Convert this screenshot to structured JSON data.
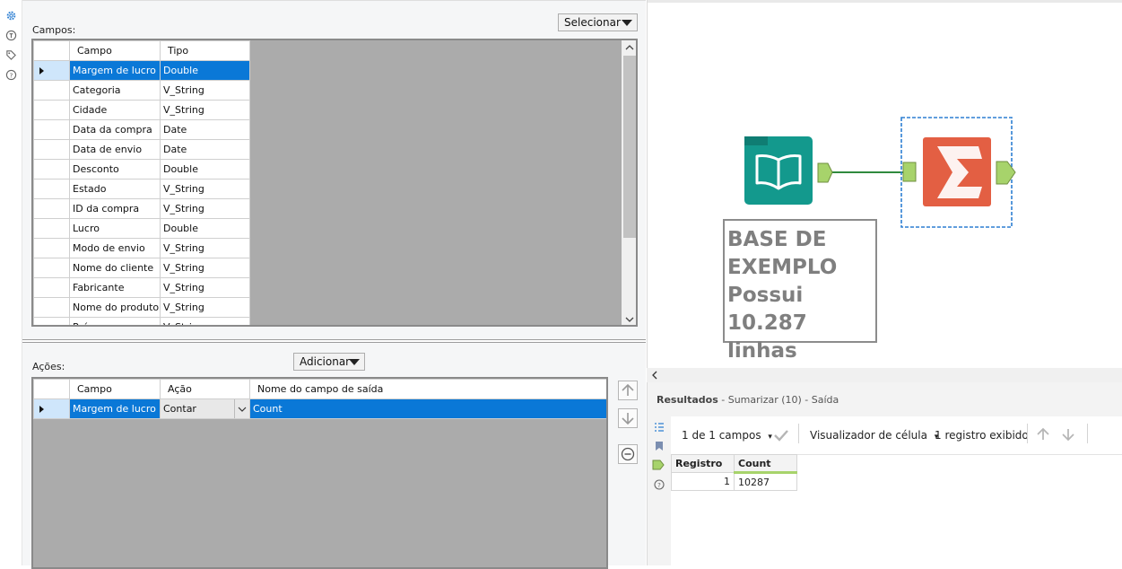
{
  "left_icons": [
    "gear-icon",
    "plug-icon",
    "tag-icon",
    "help-icon"
  ],
  "fields_section": {
    "label": "Campos:",
    "select_button": "Selecionar",
    "columns": [
      "Campo",
      "Tipo"
    ],
    "rows": [
      {
        "campo": "Margem de lucro",
        "tipo": "Double"
      },
      {
        "campo": "Categoria",
        "tipo": "V_String"
      },
      {
        "campo": "Cidade",
        "tipo": "V_String"
      },
      {
        "campo": "Data da compra",
        "tipo": "Date"
      },
      {
        "campo": "Data de envio",
        "tipo": "Date"
      },
      {
        "campo": "Desconto",
        "tipo": "Double"
      },
      {
        "campo": "Estado",
        "tipo": "V_String"
      },
      {
        "campo": "ID da compra",
        "tipo": "V_String"
      },
      {
        "campo": "Lucro",
        "tipo": "Double"
      },
      {
        "campo": "Modo de envio",
        "tipo": "V_String"
      },
      {
        "campo": "Nome do cliente",
        "tipo": "V_String"
      },
      {
        "campo": "Fabricante",
        "tipo": "V_String"
      },
      {
        "campo": "Nome do produto",
        "tipo": "V_String"
      },
      {
        "campo": "País",
        "tipo": "V_String"
      }
    ]
  },
  "actions_section": {
    "label": "Ações:",
    "add_button": "Adicionar",
    "columns": [
      "Campo",
      "Ação",
      "Nome do campo de saída"
    ],
    "rows": [
      {
        "campo": "Margem de lucro",
        "acao": "Contar",
        "saida": "Count"
      }
    ]
  },
  "canvas": {
    "comment_lines": [
      "BASE DE",
      "EXEMPLO",
      "Possui 10.287",
      "linhas"
    ],
    "input_tool_color": "#13998d",
    "summarize_tool_color": "#e35f43",
    "connector_color": "#a7d36b"
  },
  "results": {
    "title": "Resultados",
    "subtitle": " - Sumarizar (10) - Saída",
    "fields_label": "1 de 1 campos",
    "cell_viewer_label": "Visualizador de célula",
    "records_label": "1 registro exibido",
    "columns": [
      "Registro",
      "Count"
    ],
    "rows": [
      {
        "registro": "1",
        "count": "10287"
      }
    ]
  }
}
